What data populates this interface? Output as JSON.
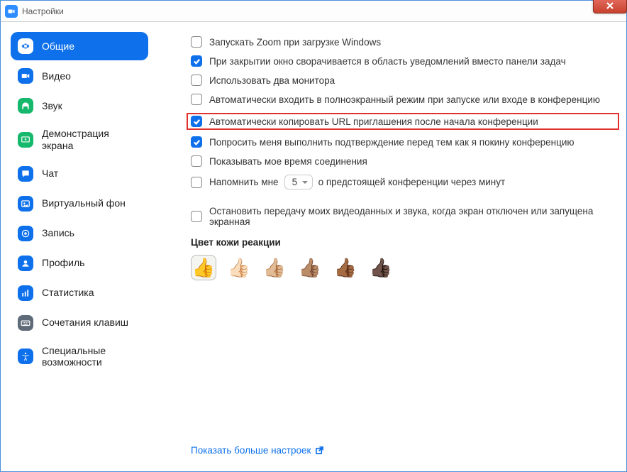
{
  "window": {
    "title": "Настройки"
  },
  "sidebar": {
    "items": [
      {
        "label": "Общие",
        "icon": "gear",
        "color": "#ffffff"
      },
      {
        "label": "Видео",
        "icon": "video",
        "color": "#0E71EB"
      },
      {
        "label": "Звук",
        "icon": "headphones",
        "color": "#16b86c"
      },
      {
        "label": "Демонстрация экрана",
        "icon": "share-screen",
        "color": "#16b86c"
      },
      {
        "label": "Чат",
        "icon": "chat",
        "color": "#0E71EB"
      },
      {
        "label": "Виртуальный фон",
        "icon": "virtual-bg",
        "color": "#0E71EB"
      },
      {
        "label": "Запись",
        "icon": "record",
        "color": "#0E71EB"
      },
      {
        "label": "Профиль",
        "icon": "profile",
        "color": "#0E71EB"
      },
      {
        "label": "Статистика",
        "icon": "stats",
        "color": "#0E71EB"
      },
      {
        "label": "Сочетания клавиш",
        "icon": "keyboard",
        "color": "#5f6a78"
      },
      {
        "label": "Специальные возможности",
        "icon": "accessibility",
        "color": "#0E71EB"
      }
    ],
    "active_index": 0
  },
  "settings": {
    "rows": [
      {
        "checked": false,
        "label": "Запускать Zoom при загрузке Windows"
      },
      {
        "checked": true,
        "label": "При закрытии окно сворачивается в область уведомлений вместо панели задач"
      },
      {
        "checked": false,
        "label": "Использовать два монитора"
      },
      {
        "checked": false,
        "label": "Автоматически входить в полноэкранный режим при запуске или входе в конференцию"
      },
      {
        "checked": true,
        "label": "Автоматически копировать URL приглашения после начала конференции",
        "highlighted": true
      },
      {
        "checked": true,
        "label": "Попросить меня выполнить подтверждение перед тем как я покину конференцию"
      },
      {
        "checked": false,
        "label": "Показывать мое время соединения"
      }
    ],
    "remind": {
      "checked": false,
      "prefix": "Напомнить мне",
      "value": "5",
      "suffix": "о предстоящей конференции через минут"
    },
    "stop_video": {
      "checked": false,
      "label": "Остановить передачу моих видеоданных и звука, когда экран отключен или запущена экранная"
    },
    "skin_tone_title": "Цвет кожи реакции",
    "skin_tones": [
      "👍",
      "👍🏻",
      "👍🏼",
      "👍🏽",
      "👍🏾",
      "👍🏿"
    ],
    "skin_tone_selected": 0,
    "more_settings": "Показать больше настроек"
  }
}
